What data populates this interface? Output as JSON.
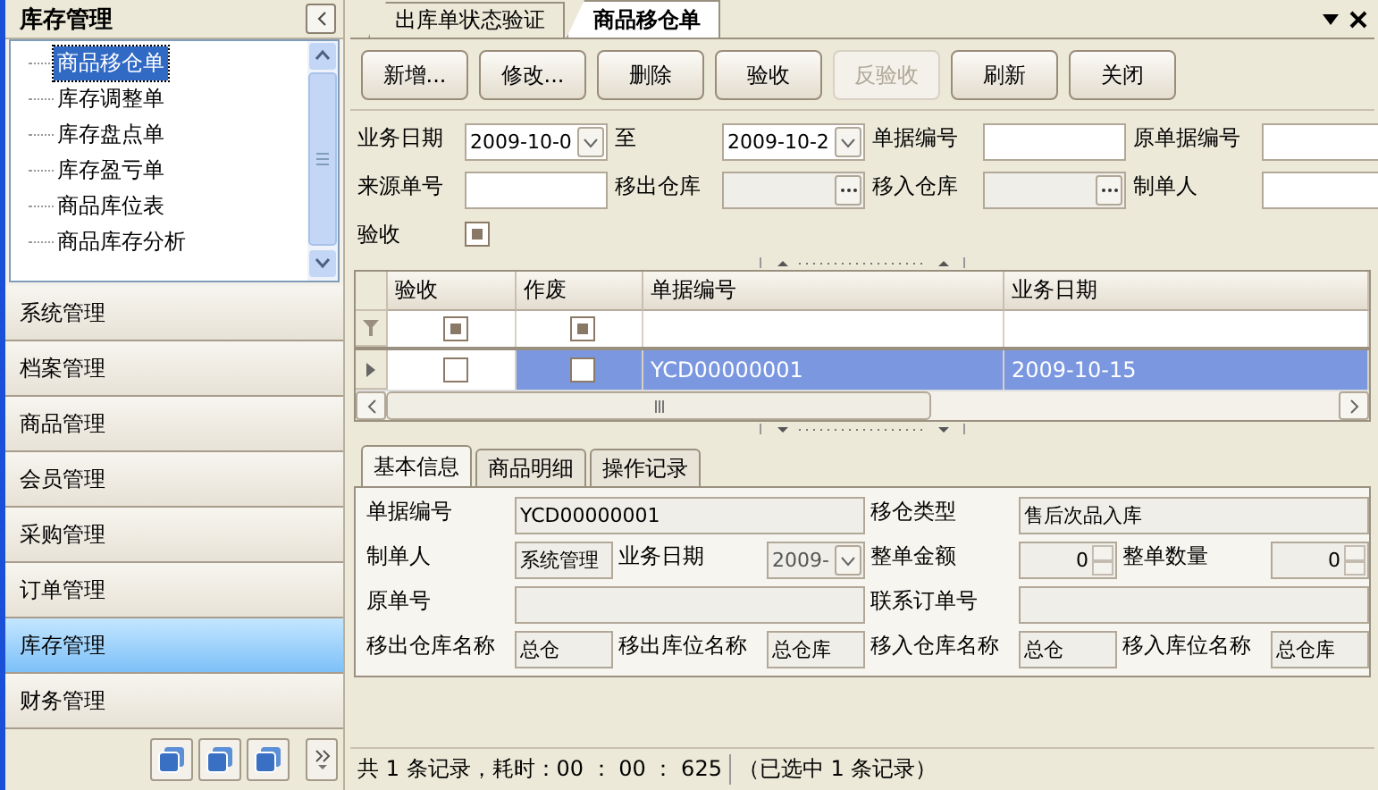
{
  "sidebar": {
    "title": "库存管理",
    "tree": [
      {
        "label": "商品移仓单",
        "selected": true
      },
      {
        "label": "库存调整单",
        "selected": false
      },
      {
        "label": "库存盘点单",
        "selected": false
      },
      {
        "label": "库存盈亏单",
        "selected": false
      },
      {
        "label": "商品库位表",
        "selected": false
      },
      {
        "label": "商品库存分析",
        "selected": false
      }
    ],
    "nav": [
      {
        "label": "系统管理",
        "selected": false
      },
      {
        "label": "档案管理",
        "selected": false
      },
      {
        "label": "商品管理",
        "selected": false
      },
      {
        "label": "会员管理",
        "selected": false
      },
      {
        "label": "采购管理",
        "selected": false
      },
      {
        "label": "订单管理",
        "selected": false
      },
      {
        "label": "库存管理",
        "selected": true
      },
      {
        "label": "财务管理",
        "selected": false
      }
    ]
  },
  "document_tabs": [
    {
      "label": "出库单状态验证",
      "selected": false
    },
    {
      "label": "商品移仓单",
      "selected": true
    }
  ],
  "toolbar": [
    {
      "label": "新增...",
      "disabled": false
    },
    {
      "label": "修改...",
      "disabled": false
    },
    {
      "label": "删除",
      "disabled": false
    },
    {
      "label": "验收",
      "disabled": false
    },
    {
      "label": "反验收",
      "disabled": true
    },
    {
      "label": "刷新",
      "disabled": false
    },
    {
      "label": "关闭",
      "disabled": false
    }
  ],
  "filter": [
    {
      "label": "业务日期",
      "kind": "date",
      "value": "2009-10-0"
    },
    {
      "label": "至",
      "kind": "date",
      "value": "2009-10-2"
    },
    {
      "label": "单据编号",
      "kind": "text"
    },
    {
      "label": "原单据编号",
      "kind": "text"
    },
    {
      "label": "来源单号",
      "kind": "text"
    },
    {
      "label": "移出仓库",
      "kind": "lookup"
    },
    {
      "label": "移入仓库",
      "kind": "lookup"
    },
    {
      "label": "制单人",
      "kind": "text"
    },
    {
      "label": "验收",
      "kind": "checkbox",
      "indeterminate": true
    }
  ],
  "grid": {
    "columns": [
      "验收",
      "作废",
      "单据编号",
      "业务日期"
    ],
    "filter_row": [
      {
        "indeterminate": true
      },
      {
        "indeterminate": true
      }
    ],
    "rows": [
      {
        "accepted": false,
        "voided": false,
        "number": "YCD00000001",
        "date": "2009-10-15",
        "selected": true
      }
    ]
  },
  "detail": {
    "tabs": [
      {
        "label": "基本信息",
        "selected": true
      },
      {
        "label": "商品明细",
        "selected": false
      },
      {
        "label": "操作记录",
        "selected": false
      }
    ],
    "fields": [
      {
        "label": "单据编号",
        "kind": "text",
        "wide": true,
        "value": "YCD00000001"
      },
      {
        "label": "移仓类型",
        "kind": "text",
        "wide": true,
        "value": "售后次品入库"
      },
      {
        "label": "制单人",
        "kind": "text",
        "wide": false,
        "value": "系统管理"
      },
      {
        "label": "业务日期",
        "kind": "date",
        "wide": false,
        "value": "2009-"
      },
      {
        "label": "整单金额",
        "kind": "number",
        "wide": false,
        "value": "0"
      },
      {
        "label": "整单数量",
        "kind": "number",
        "wide": false,
        "value": "0"
      },
      {
        "label": "原单号",
        "kind": "text",
        "wide": true
      },
      {
        "label": "联系订单号",
        "kind": "text",
        "wide": true
      },
      {
        "label": "移出仓库名称",
        "kind": "text",
        "wide": false,
        "value": "总仓"
      },
      {
        "label": "移出库位名称",
        "kind": "text",
        "wide": false,
        "value": "总仓库"
      },
      {
        "label": "移入仓库名称",
        "kind": "text",
        "wide": false,
        "value": "总仓"
      },
      {
        "label": "移入库位名称",
        "kind": "text",
        "wide": false,
        "value": "总仓库"
      }
    ]
  },
  "status_bar": {
    "records": "共 1 条记录，耗时：00 ： 00 ： 625",
    "selection": "（已选中 1 条记录）"
  }
}
